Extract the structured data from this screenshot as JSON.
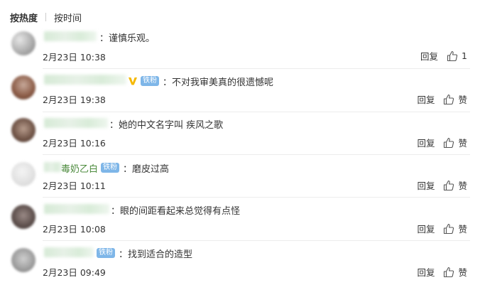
{
  "sort": {
    "hot_label": "按热度",
    "time_label": "按时间"
  },
  "comments": [
    {
      "name": "",
      "badge": "",
      "verified": false,
      "text": "谨慎乐观。",
      "time": "2月23日 10:38",
      "reply": "回复",
      "like": "1"
    },
    {
      "name": "",
      "badge": "铁粉",
      "verified": true,
      "text": "不对我审美真的很遗憾呢",
      "time": "2月23日 19:38",
      "reply": "回复",
      "like": "赞"
    },
    {
      "name": "",
      "badge": "",
      "verified": false,
      "text": "她的中文名字叫 疾风之歌",
      "time": "2月23日 10:16",
      "reply": "回复",
      "like": "赞"
    },
    {
      "name": "毒奶乙白",
      "badge": "铁粉",
      "verified": false,
      "text": "磨皮过高",
      "time": "2月23日 10:11",
      "reply": "回复",
      "like": "赞"
    },
    {
      "name": "",
      "badge": "",
      "verified": false,
      "text": "眼的间距看起来总觉得有点怪",
      "time": "2月23日 10:08",
      "reply": "回复",
      "like": "赞"
    },
    {
      "name": "",
      "badge": "铁粉",
      "verified": false,
      "text": "找到适合的造型",
      "time": "2月23日 09:49",
      "reply": "回复",
      "like": "赞"
    }
  ],
  "colors": {
    "name_green": "#4b8a3c",
    "badge_blue": "#7eb6e8",
    "verified_gold": "#f5b800"
  },
  "icons": {
    "like": "thumbs-up-icon",
    "verified": "verified-v-icon"
  }
}
